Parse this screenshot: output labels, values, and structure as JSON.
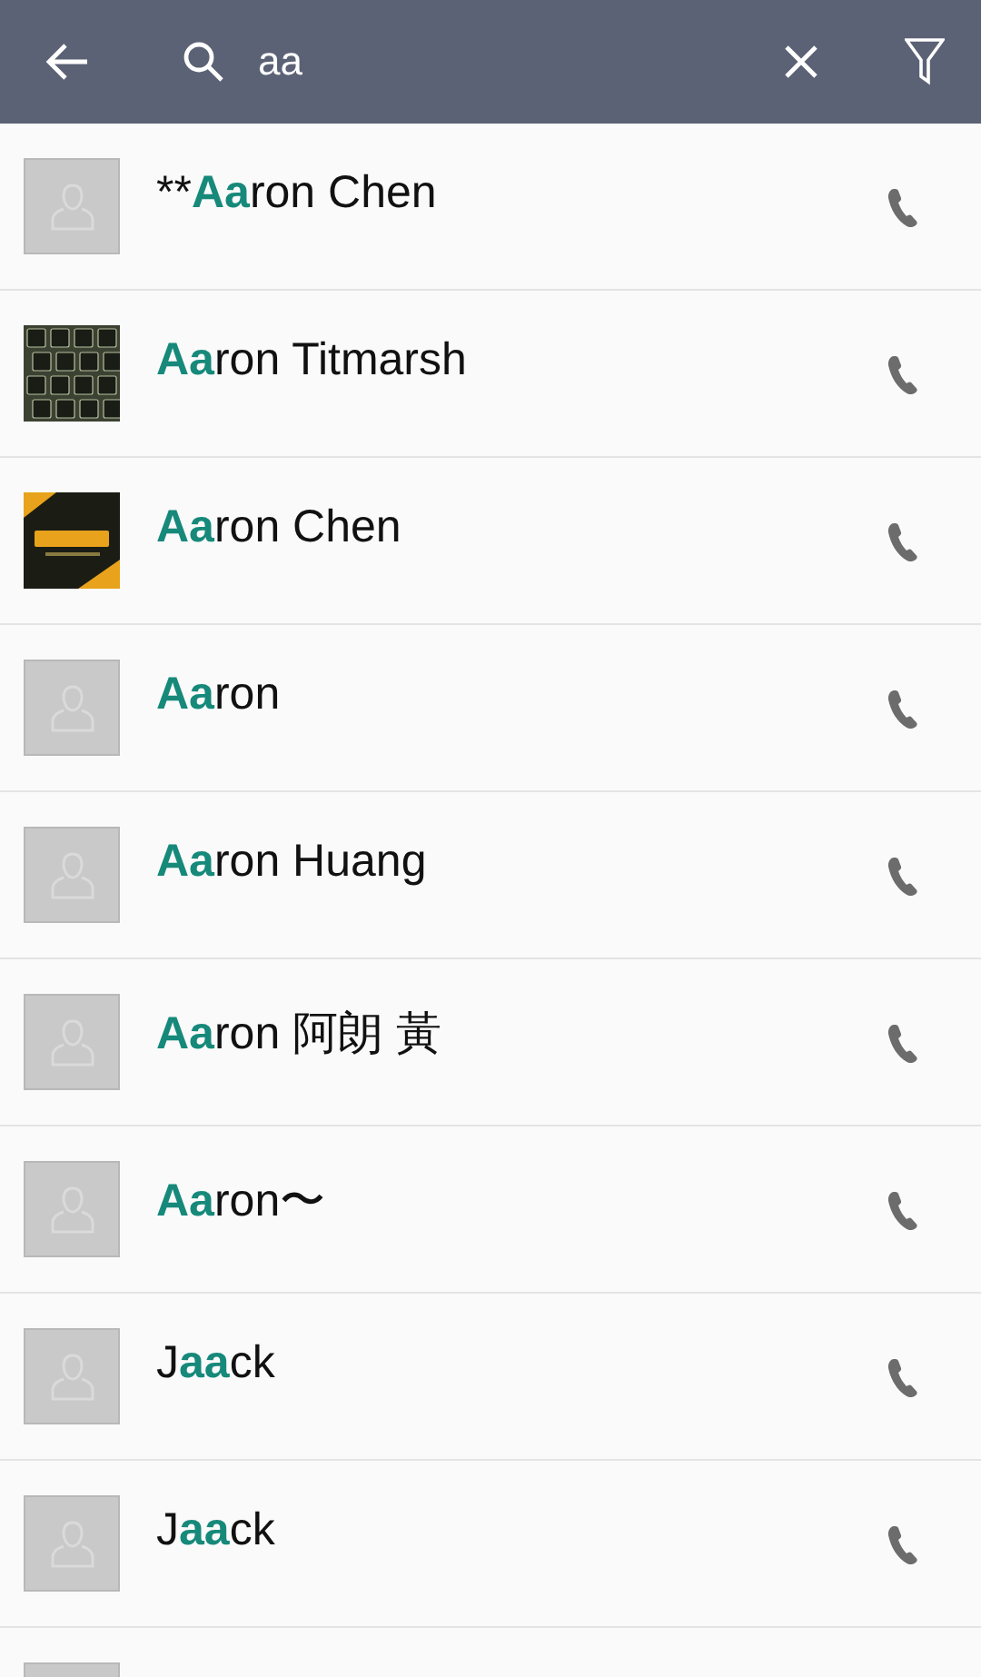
{
  "search_bar": {
    "query": "aa"
  },
  "contacts": [
    {
      "kind": "placeholder",
      "name": {
        "before": "**",
        "match": "Aa",
        "after": "ron Chen"
      }
    },
    {
      "kind": "picture",
      "name": {
        "match": "Aa",
        "after": "ron Titmarsh"
      }
    },
    {
      "kind": "picture",
      "name": {
        "match": "Aa",
        "after": "ron Chen"
      }
    },
    {
      "kind": "placeholder",
      "name": {
        "match": "Aa",
        "after": "ron"
      }
    },
    {
      "kind": "placeholder",
      "name": {
        "match": "Aa",
        "after": "ron Huang"
      }
    },
    {
      "kind": "placeholder",
      "name": {
        "match": "Aa",
        "after": "ron 阿朗 黃"
      }
    },
    {
      "kind": "placeholder",
      "name": {
        "match": "Aa",
        "after": "ron〜"
      }
    },
    {
      "kind": "placeholder",
      "name": {
        "before": "J",
        "match": "aa",
        "after": "ck"
      }
    },
    {
      "kind": "placeholder",
      "name": {
        "before": "J",
        "match": "aa",
        "after": "ck"
      }
    },
    {
      "kind": "placeholder"
    }
  ]
}
